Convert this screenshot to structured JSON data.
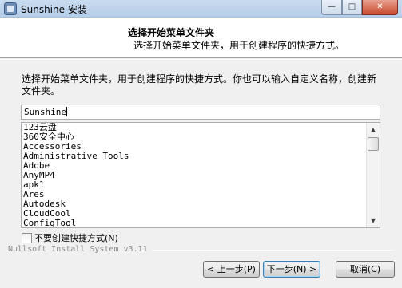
{
  "window": {
    "title": "Sunshine 安装",
    "controls": {
      "minimize": "—",
      "maximize": "□",
      "close": "✕"
    }
  },
  "header": {
    "title": "选择开始菜单文件夹",
    "subtitle": "选择开始菜单文件夹，用于创建程序的快捷方式。"
  },
  "instructions": "选择开始菜单文件夹，用于创建程序的快捷方式。你也可以输入自定义名称，创建新文件夹。",
  "folder_input": {
    "value": "Sunshine"
  },
  "folder_list": {
    "items": [
      "123云盘",
      "360安全中心",
      "Accessories",
      "Administrative Tools",
      "Adobe",
      "AnyMP4",
      "apk1",
      "Ares",
      "Autodesk",
      "CloudCool",
      "ConfigTool"
    ],
    "scroll_up": "▲",
    "scroll_down": "▼"
  },
  "no_shortcut_checkbox": {
    "label": "不要创建快捷方式(N)",
    "checked": false
  },
  "branding": "Nullsoft Install System v3.11",
  "buttons": {
    "back": "< 上一步(P)",
    "next": "下一步(N) >",
    "cancel": "取消(C)"
  }
}
